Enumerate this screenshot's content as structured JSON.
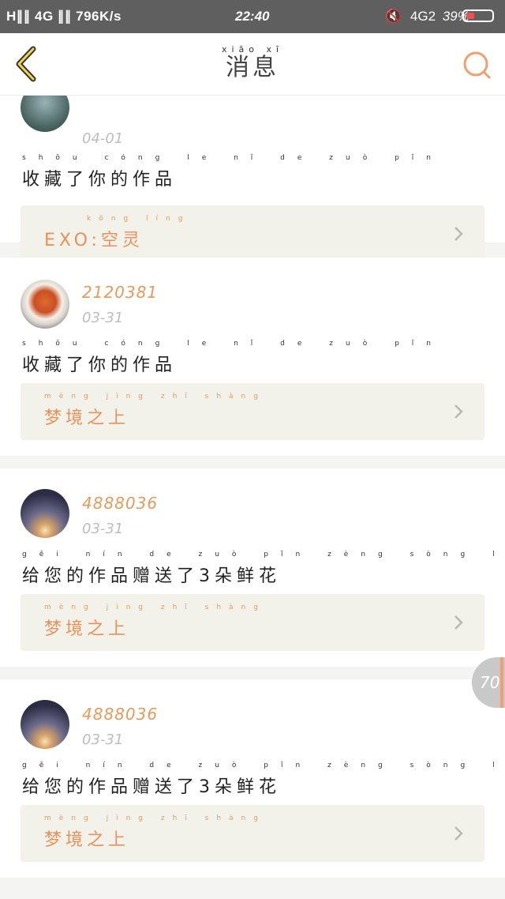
{
  "status_bar": {
    "left": "H∥∥ 4G ∥∥ 796K/s",
    "time": "22:40",
    "network": "4G2",
    "battery": "39%"
  },
  "header": {
    "title_pinyin": "xiāo xī",
    "title": "消息"
  },
  "feed": [
    {
      "username": "",
      "date": "04-01",
      "message_pinyin": "shōu cóng le nǐ de zuò pǐn",
      "message": "收藏了你的作品",
      "work_pinyin": "kōng líng",
      "work_title": "EXO:空灵"
    },
    {
      "username": "2120381",
      "date": "03-31",
      "message_pinyin": "shōu cóng le nǐ de zuò pǐn",
      "message": "收藏了你的作品",
      "work_pinyin": "mèng jìng zhī shàng",
      "work_title": "梦境之上"
    },
    {
      "username": "4888036",
      "date": "03-31",
      "message_pinyin": "gěi nín de zuò pǐn zèng sòng le duǒ xiān huā",
      "message": "给您的作品赠送了3朵鲜花",
      "work_pinyin": "mèng jìng zhī shàng",
      "work_title": "梦境之上"
    },
    {
      "username": "4888036",
      "date": "03-31",
      "message_pinyin": "gěi nín de zuò pǐn zèng sòng le duǒ xiān huā",
      "message": "给您的作品赠送了3朵鲜花",
      "work_pinyin": "mèng jìng zhī shàng",
      "work_title": "梦境之上"
    }
  ],
  "float_badge": "70",
  "colors": {
    "accent": "#e89a5c",
    "card_box": "#f2f2ea",
    "status_bar": "#5f5f5f"
  }
}
